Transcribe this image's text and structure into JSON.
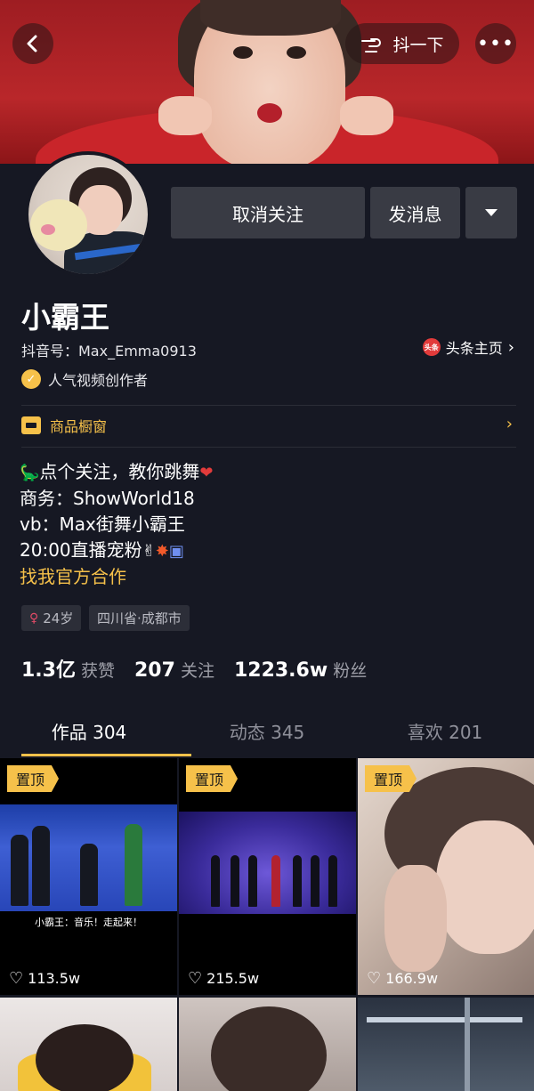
{
  "header": {
    "shake_label": "抖一下",
    "more_label": "•••"
  },
  "actions": {
    "unfollow_label": "取消关注",
    "message_label": "发消息"
  },
  "profile": {
    "nickname": "小霸王",
    "douyin_id": "抖音号：Max_Emma0913",
    "toutiao_badge": "头条",
    "toutiao_label": "头条主页",
    "creator_label": "人气视频创作者",
    "shop_label": "商品橱窗",
    "bio": [
      "点个关注，教你跳舞",
      "商务：ShowWorld18",
      "vb：Max街舞小霸王",
      "20:00直播宠粉"
    ],
    "bio_link": "找我官方合作",
    "tags": {
      "age": "24岁",
      "location": "四川省·成都市"
    }
  },
  "stats": [
    {
      "value": "1.3亿",
      "label": "获赞"
    },
    {
      "value": "207",
      "label": "关注"
    },
    {
      "value": "1223.6w",
      "label": "粉丝"
    }
  ],
  "tabs": [
    {
      "label": "作品 304",
      "active": true
    },
    {
      "label": "动态 345",
      "active": false
    },
    {
      "label": "喜欢 201",
      "active": false
    }
  ],
  "videos": [
    {
      "pinned": "置顶",
      "likes": "113.5w",
      "caption": "小霸王：音乐！走起来！"
    },
    {
      "pinned": "置顶",
      "likes": "215.5w"
    },
    {
      "pinned": "置顶",
      "likes": "166.9w"
    }
  ],
  "colors": {
    "accent": "#f6c14a",
    "background": "#161823",
    "button": "#393b44"
  }
}
